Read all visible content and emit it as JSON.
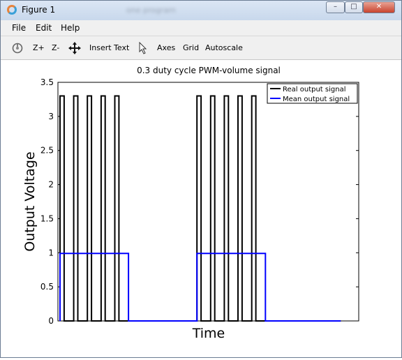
{
  "window": {
    "title": "Figure 1",
    "blurred_text": "one program",
    "controls": {
      "minimize": "–",
      "maximize": "□",
      "close": "✕"
    }
  },
  "menu": {
    "file": "File",
    "edit": "Edit",
    "help": "Help"
  },
  "toolbar": {
    "zoom_in": "Z+",
    "zoom_out": "Z-",
    "insert_text": "Insert Text",
    "axes": "Axes",
    "grid": "Grid",
    "autoscale": "Autoscale"
  },
  "chart_data": {
    "type": "line",
    "title": "0.3 duty cycle PWM-volume signal",
    "xlabel": "Time",
    "ylabel": "Output Voltage",
    "xlim": [
      0,
      420
    ],
    "ylim": [
      0,
      3.5
    ],
    "yticks": [
      "0",
      "0.5",
      "1",
      "1.5",
      "2",
      "2.5",
      "3",
      "3.5"
    ],
    "grid": false,
    "legend_position": "top-right",
    "series": [
      {
        "name": "Real output signal",
        "color": "#000000",
        "x": [
          0,
          0,
          6,
          6,
          20,
          20,
          26,
          26,
          40,
          40,
          46,
          46,
          60,
          60,
          66,
          66,
          80,
          80,
          86,
          86,
          100,
          100,
          200,
          200,
          206,
          206,
          220,
          220,
          226,
          226,
          240,
          240,
          246,
          246,
          260,
          260,
          266,
          266,
          280,
          280,
          286,
          286,
          300,
          300,
          410
        ],
        "y": [
          0,
          3.3,
          3.3,
          0,
          0,
          3.3,
          3.3,
          0,
          0,
          3.3,
          3.3,
          0,
          0,
          3.3,
          3.3,
          0,
          0,
          3.3,
          3.3,
          0,
          0,
          0,
          0,
          3.3,
          3.3,
          0,
          0,
          3.3,
          3.3,
          0,
          0,
          3.3,
          3.3,
          0,
          0,
          3.3,
          3.3,
          0,
          0,
          3.3,
          3.3,
          0,
          0,
          0,
          0
        ]
      },
      {
        "name": "Mean output signal",
        "color": "#0000ff",
        "x": [
          0,
          0,
          100,
          100,
          200,
          200,
          300,
          300,
          410
        ],
        "y": [
          0,
          0.99,
          0.99,
          0,
          0,
          0.99,
          0.99,
          0,
          0
        ]
      }
    ]
  }
}
